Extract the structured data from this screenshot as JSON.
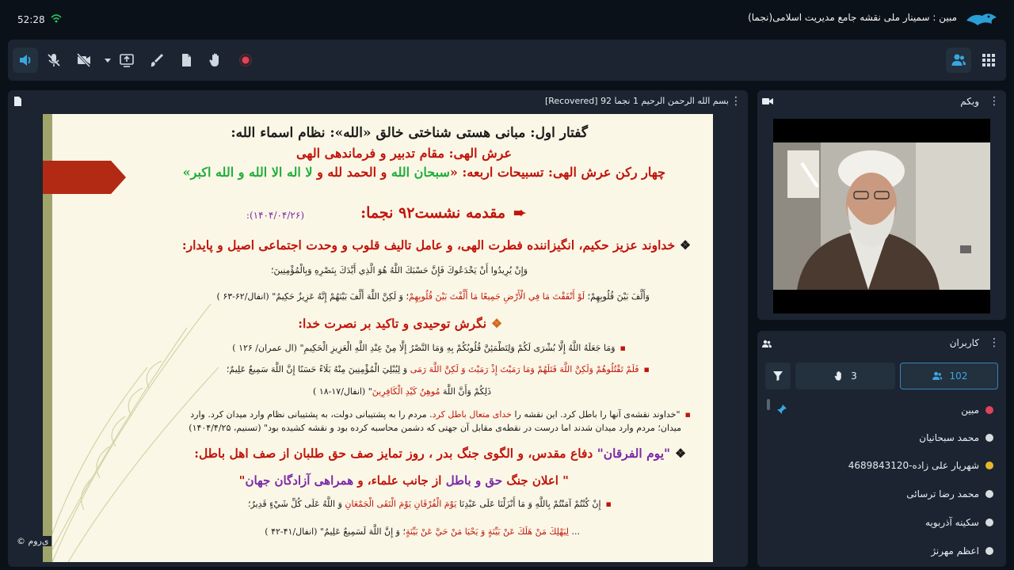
{
  "status": {
    "time": "52:28"
  },
  "app": {
    "title": "مبین : سمینار ملی نقشه جامع مدیریت اسلامی(نجما)"
  },
  "toolbar": {
    "items": [
      {
        "name": "speaker-icon"
      },
      {
        "name": "mic-off-icon"
      },
      {
        "name": "camera-off-icon"
      },
      {
        "name": "share-screen-icon"
      },
      {
        "name": "brush-icon"
      },
      {
        "name": "files-icon"
      },
      {
        "name": "raise-hand-icon"
      },
      {
        "name": "record-icon"
      },
      {
        "name": "users-icon"
      },
      {
        "name": "grid-icon"
      }
    ]
  },
  "presentation": {
    "title": "بسم الله الرحمن الرحیم 1 نجما 92 [Recovered]",
    "copyright": "© ی‌روم",
    "slide": {
      "line1": "گفتار اول: مبانی هستی شناختی خالق «الله»: نظام اسماء الله:",
      "line2": "عرش الهی: مقام تدبیر و فرماندهی الهی",
      "line3_a": "چهار رکن عرش الهی: تسبیحات اربعه: «",
      "line3_b": "سبحان الله",
      "line3_c": " و ",
      "line3_d": "الحمد لله",
      "line3_e": " و ",
      "line3_f": "لا اله الا الله",
      "line3_g": " و ",
      "line3_h": "الله اکبر",
      "line3_i": "»",
      "heading": "مقدمه نشست۹۲ نجما:",
      "heading_date": "(۱۴۰۴/۰۴/۲۶):",
      "bullet1": "خداوند عزیز حکیم، انگیزاننده فطرت الهی، و عامل تالیف قلوب و وحدت اجتماعی اصیل و پایدار:",
      "verse1": "وَإِنْ يُرِيدُوا أَنْ يَخْدَعُوكَ فَإِنَّ حَسْبَكَ اللَّهُ هُوَ الَّذِي أَيَّدَكَ بِنَصْرِهِ وَبِالْمُؤْمِنِينَ؛",
      "verse2_a": "وَأَلَّفَ بَيْنَ قُلُوبِهِمْ؛ ",
      "verse2_b": "لَوْ أَنْفَقْتَ مَا فِي الْأَرْضِ جَمِيعًا مَا أَلَّفْتَ بَيْنَ قُلُوبِهِمْ",
      "verse2_c": "؛ وَ لَكِنَّ اللَّهَ أَلَّفَ بَيْنَهُمْ إِنَّهُ عَزِيزٌ حَكِيمٌ\" (انفال/۶۲-۶۳ )",
      "bullet2": "نگرش توحیدی و تاکید بر نصرت خدا:",
      "verse3": "وَمَا جَعَلَهُ اللَّهُ إِلَّا بُشْرَى لَكُمْ وَلِتَطْمَئِنَّ قُلُوبُكُمْ بِهِ وَمَا النَّصْرُ إِلَّا مِنْ عِنْدِ اللَّهِ الْعَزِيزِ الْحَكِيمِ\" (ال عمران/ ۱۲۶ )",
      "verse4_a": "فَلَمْ تَقْتُلُوهُمْ وَلَكِنَّ اللَّهَ قَتَلَهُمْ وَمَا رَمَيْتَ إِذْ رَمَيْتَ وَ لَكِنَّ اللَّهَ رَمَى",
      "verse4_b": " وَ لِيُبْلِيَ الْمُؤْمِنِينَ مِنْهُ بَلَاءً حَسَنًا إِنَّ اللَّهَ سَمِيعٌ عَلِيمٌ؛",
      "verse5_a": "ذَلِكُمْ وَأَنَّ اللَّهَ ",
      "verse5_b": "مُوهِنُ كَيْدِ الْكَافِرِينَ",
      "verse5_c": "\" (انفال/۱۷-۱۸ )",
      "note_a": "\"خداوند نقشه‌ی آنها را باطل کرد. این نقشه را ",
      "note_b": "خدای متعال باطل کرد",
      "note_c": ". مردم را به پشتیبانی دولت، به پشتیبانی نظام وارد میدان کرد. وارد",
      "note_line2": "میدان؛ مردم وارد میدان شدند اما درست در نقطه‌ی مقابل آن جهتی که دشمن محاسبه کرده بود و نقشه کشیده بود\" (تسنیم، ۱۴۰۴/۴/۲۵)",
      "bullet3_a": "\"یوم الفرقان\"",
      "bullet3_b": " دفاع مقدس، و الگوی جنگ بدر ، ",
      "bullet3_c": "روز تمایز صف حق طلبان از صف اهل باطل:",
      "sub_a": "\" اعلان جنگ ",
      "sub_b": "حق و باطل",
      "sub_c": " از جانب علماء، و ",
      "sub_d": "همراهی آزادگان جهان",
      "sub_e": "\"",
      "verse6_a": "إِنْ كُنْتُمْ آمَنْتُمْ بِاللَّهِ وَ مَا أَنْزَلْنَا عَلَى عَبْدِنَا ",
      "verse6_b": "يَوْمَ الْفُرْقَانِ يَوْمَ الْتَقَى الْجَمْعَانِ",
      "verse6_c": " وَ اللَّهُ عَلَى كُلِّ شَيْءٍ قَدِيرٌ؛",
      "verse7_a": "... ",
      "verse7_b": "لِيَهْلِكَ مَنْ هَلَكَ عَنْ بَيِّنَةٍ وَ يَحْيَا مَنْ حَيَّ عَنْ بَيِّنَةٍ",
      "verse7_c": "؛ وَ إِنَّ اللَّهَ لَسَمِيعٌ عَلِيمٌ\" (انفال/۴۱-۴۲ )"
    }
  },
  "webcam": {
    "label": "وبکم"
  },
  "users": {
    "label": "کاربران",
    "raised_hands": "3",
    "total": "102",
    "list": [
      {
        "name": "مبین",
        "color": "#e0435a"
      },
      {
        "name": "محمد سبحانیان",
        "color": "#d8dde2"
      },
      {
        "name": "شهریار علی زاده-4689843120",
        "color": "#e5b82a"
      },
      {
        "name": "محمد رضا ترسائی",
        "color": "#d8dde2"
      },
      {
        "name": "سکینه آذربویه",
        "color": "#d8dde2"
      },
      {
        "name": "اعظم مهرنژ",
        "color": "#d8dde2"
      }
    ]
  }
}
